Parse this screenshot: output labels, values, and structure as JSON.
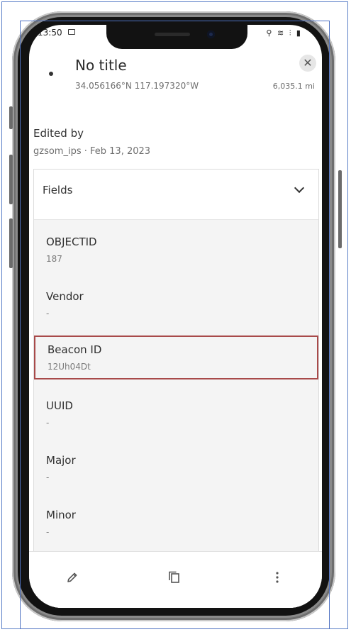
{
  "status_bar": {
    "time": "13:50",
    "right_icons": "⚲ ≋ ⫶ ▮"
  },
  "header": {
    "title": "No title",
    "coordinates": "34.056166°N  117.197320°W",
    "distance": "6,035.1 mi",
    "close_label": "✕"
  },
  "edited": {
    "label": "Edited by",
    "meta": "gzsom_ips · Feb 13, 2023"
  },
  "fields_section": {
    "title": "Fields",
    "fields": [
      {
        "label": "OBJECTID",
        "value": "187"
      },
      {
        "label": "Vendor",
        "value": "-"
      },
      {
        "label": "Beacon ID",
        "value": "12Uh04Dt"
      },
      {
        "label": "UUID",
        "value": "-"
      },
      {
        "label": "Major",
        "value": "-"
      },
      {
        "label": "Minor",
        "value": "-"
      }
    ]
  },
  "toolbar": {
    "icons": [
      "pencil-icon",
      "copy-icon",
      "more-vertical-icon"
    ]
  },
  "colors": {
    "highlight_border": "#a84a4a",
    "frame_blue": "#4f72c2"
  }
}
